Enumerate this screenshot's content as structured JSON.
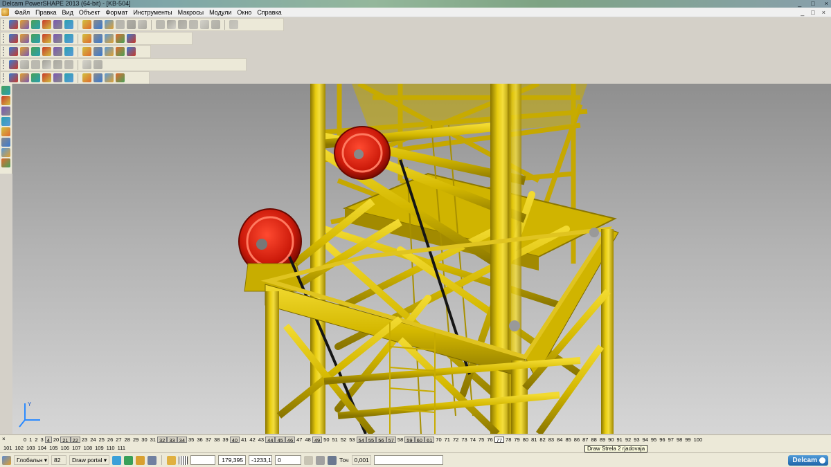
{
  "window": {
    "title": "Delcam PowerSHAPE 2013 (64-bit) - [KB-504]",
    "controls": [
      "_",
      "□",
      "×"
    ]
  },
  "menu": [
    "Файл",
    "Правка",
    "Вид",
    "Объект",
    "Формат",
    "Инструменты",
    "Макросы",
    "Модули",
    "Окно",
    "Справка"
  ],
  "mdi_controls": [
    "_",
    "□",
    "×"
  ],
  "toolbars": {
    "row1_icons": [
      "new-icon",
      "open-icon",
      "save-icon",
      "save-as-icon",
      "print-icon",
      "cut-icon",
      "copy-icon",
      "paste-icon",
      "delete-icon",
      "undo-icon",
      "redo-icon",
      "select-icon",
      "render-icon",
      "line-icon",
      "circle-icon",
      "curve-icon",
      "text-icon",
      "dimension-icon",
      "shaded-icon"
    ],
    "row2_icons": [
      "wireframe-icon",
      "view-top-icon",
      "view-front-icon",
      "view-iso-icon",
      "zoom-icon",
      "pan-icon",
      "rotate-icon",
      "fit-icon",
      "globe-icon",
      "sphere-icon",
      "light-icon"
    ],
    "row3_icons": [
      "workplane-icon",
      "solid-icon",
      "surface-icon",
      "assembly-icon",
      "mesh-icon",
      "sphere-red-icon",
      "play-icon",
      "arrow-icon",
      "layer-icon",
      "box-icon",
      "shield-icon"
    ],
    "row4_icons": [
      "block-icon",
      "cube-icon",
      "cylinder-icon",
      "cone-icon",
      "torus-icon",
      "extrude-icon",
      "revolve-icon",
      "boolean-icon"
    ],
    "row5_icons": [
      "model-icon",
      "axis-icon",
      "solid-cube-icon",
      "feature-icon",
      "curve-tool-icon",
      "gear-icon",
      "tree-icon",
      "cog-icon",
      "filter-icon",
      "drop-icon"
    ]
  },
  "left_toolbar": [
    "select-arrow-icon",
    "layers-icon",
    "solid-tool-icon",
    "cube-tool-icon",
    "sweep-icon",
    "fillet-icon",
    "shell-icon",
    "boolean-tool-icon"
  ],
  "viewport": {
    "scene": "yellow lattice crane mast with red sheave pulleys",
    "colors": {
      "steel": "#d4b800",
      "steel_dark": "#8a7600",
      "pulley": "#cc1a0a",
      "cable": "#1a1a1a",
      "bg_top": "#8f8f8f",
      "bg_bottom": "#d6d6d6"
    },
    "axis_label": "Y"
  },
  "levels": {
    "row1": [
      {
        "n": "0"
      },
      {
        "n": "1"
      },
      {
        "n": "2"
      },
      {
        "n": "3"
      },
      {
        "n": "4",
        "on": true
      },
      {
        "n": "20"
      },
      {
        "n": "21",
        "on": true
      },
      {
        "n": "22",
        "on": true
      },
      {
        "n": "23"
      },
      {
        "n": "24"
      },
      {
        "n": "25"
      },
      {
        "n": "26"
      },
      {
        "n": "27"
      },
      {
        "n": "28"
      },
      {
        "n": "29"
      },
      {
        "n": "30"
      },
      {
        "n": "31"
      },
      {
        "n": "32",
        "on": true
      },
      {
        "n": "33",
        "on": true
      },
      {
        "n": "34",
        "on": true
      },
      {
        "n": "35"
      },
      {
        "n": "36"
      },
      {
        "n": "37"
      },
      {
        "n": "38"
      },
      {
        "n": "39"
      },
      {
        "n": "40",
        "on": true
      },
      {
        "n": "41"
      },
      {
        "n": "42"
      },
      {
        "n": "43"
      },
      {
        "n": "44",
        "on": true
      },
      {
        "n": "45",
        "on": true
      },
      {
        "n": "46",
        "on": true
      },
      {
        "n": "47"
      },
      {
        "n": "48"
      },
      {
        "n": "49",
        "on": true
      },
      {
        "n": "50"
      },
      {
        "n": "51"
      },
      {
        "n": "52"
      },
      {
        "n": "53"
      },
      {
        "n": "54",
        "on": true
      },
      {
        "n": "55",
        "on": true
      },
      {
        "n": "56",
        "on": true
      },
      {
        "n": "57",
        "on": true
      },
      {
        "n": "58"
      },
      {
        "n": "59",
        "on": true
      },
      {
        "n": "60",
        "on": true
      },
      {
        "n": "61",
        "on": true
      },
      {
        "n": "70"
      },
      {
        "n": "71"
      },
      {
        "n": "72"
      },
      {
        "n": "73"
      },
      {
        "n": "74"
      },
      {
        "n": "75"
      },
      {
        "n": "76"
      },
      {
        "n": "77",
        "hl": true
      },
      {
        "n": "78"
      },
      {
        "n": "79"
      },
      {
        "n": "80"
      },
      {
        "n": "81"
      },
      {
        "n": "82"
      },
      {
        "n": "83"
      },
      {
        "n": "84"
      },
      {
        "n": "85"
      },
      {
        "n": "86"
      },
      {
        "n": "87"
      },
      {
        "n": "88"
      },
      {
        "n": "89"
      },
      {
        "n": "90"
      },
      {
        "n": "91"
      },
      {
        "n": "92"
      },
      {
        "n": "93"
      },
      {
        "n": "94"
      },
      {
        "n": "95"
      },
      {
        "n": "96"
      },
      {
        "n": "97"
      },
      {
        "n": "98"
      },
      {
        "n": "99"
      },
      {
        "n": "100"
      }
    ],
    "row2": [
      "101",
      "102",
      "103",
      "104",
      "105",
      "106",
      "107",
      "108",
      "109",
      "110",
      "111"
    ]
  },
  "tooltip": "Draw Strela 2 rjadovaja",
  "status": {
    "workplane": "Глобальн",
    "level_number": "82",
    "level_name": "Draw portal",
    "x": "179,395",
    "y": "-1233,1",
    "z": "0",
    "tolerance_label": "Точ",
    "tolerance_value": "0,001",
    "brand": "Delcam"
  }
}
